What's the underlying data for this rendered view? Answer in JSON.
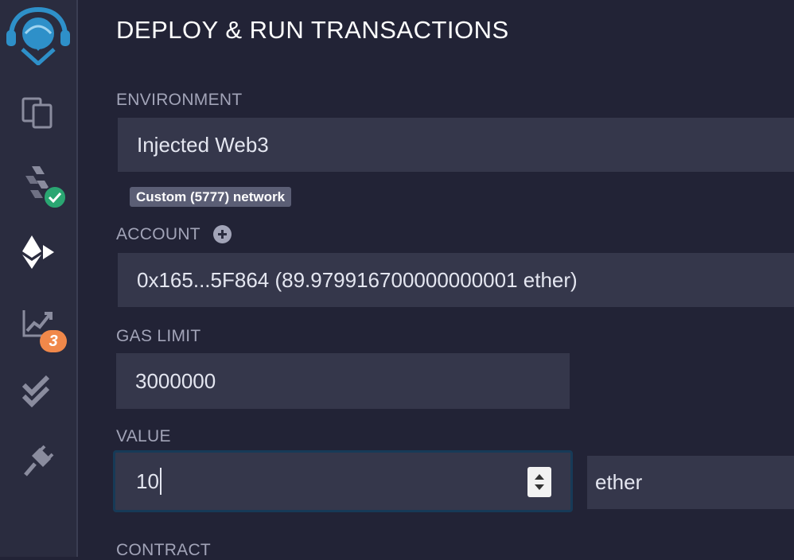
{
  "sidebar": {
    "icons": [
      "remix-logo-icon",
      "file-explorer-icon",
      "solidity-compiler-icon",
      "deploy-run-icon",
      "analysis-icon",
      "test-icon",
      "plugin-manager-icon"
    ],
    "analysis_badge": "3"
  },
  "panel": {
    "title": "DEPLOY & RUN TRANSACTIONS",
    "environment": {
      "label": "ENVIRONMENT",
      "value": "Injected Web3",
      "network": "Custom (5777) network"
    },
    "account": {
      "label": "ACCOUNT",
      "value": "0x165...5F864 (89.979916700000000001 ether)"
    },
    "gas_limit": {
      "label": "GAS LIMIT",
      "value": "3000000"
    },
    "value": {
      "label": "VALUE",
      "amount": "10",
      "unit": "ether"
    },
    "contract": {
      "label": "CONTRACT"
    }
  },
  "colors": {
    "background": "#222336",
    "sidebar": "#2a2c3f",
    "field": "#35374b",
    "logo": "#2e90c9",
    "success": "#2aa672",
    "badge": "#f0884a"
  }
}
